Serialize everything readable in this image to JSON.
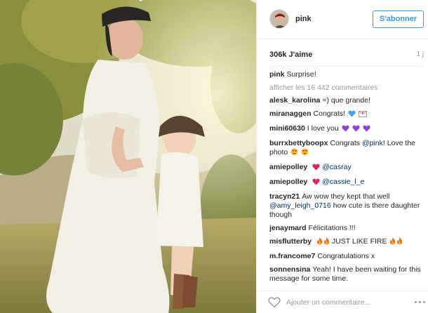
{
  "post": {
    "username": "pink",
    "follow_label": "S'abonner",
    "likes": "306k J'aime",
    "time": "1 j",
    "caption_user": "pink",
    "caption_text": "Surprise!",
    "view_all": "afficher les 16 442 commentaires",
    "comment_placeholder": "Ajouter un commentaire..."
  },
  "comments": [
    {
      "user": "alesk_karolina",
      "text": "=) que grande!"
    },
    {
      "user": "miranaggen",
      "text": "Congrats!"
    },
    {
      "user": "mini60630",
      "text": "I love you"
    },
    {
      "user": "burrxbettyboopx",
      "text": "Congrats",
      "mention": "@pink",
      "text2": "! Love the photo"
    },
    {
      "user": "amiepolley",
      "mention": "@casray"
    },
    {
      "user": "amiepolley",
      "mention": "@cassie_l_e"
    },
    {
      "user": "tracyn21",
      "text": "Aw wow they kept that well",
      "mention": "@amy_leigh_0716",
      "text2": "how cute is there daughter though"
    },
    {
      "user": "jenaymard",
      "text": "Félicitations !!!"
    },
    {
      "user": "misflutterby",
      "text": "JUST LIKE FIRE"
    },
    {
      "user": "m.francome7",
      "text": "Congratulations x"
    },
    {
      "user": "sonnensina",
      "text": "Yeah! I have been waiting for this message for some time."
    }
  ],
  "icons": {
    "heart": "heart-outline-icon",
    "more": "ellipsis-icon",
    "avatar": "avatar"
  },
  "colors": {
    "accent": "#3897f0",
    "link": "#003569",
    "muted": "#999999"
  }
}
